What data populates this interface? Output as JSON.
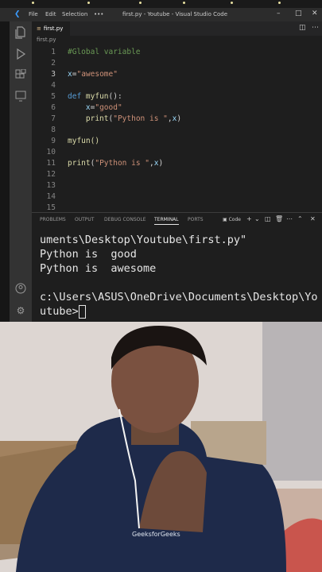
{
  "window": {
    "title": "first.py - Youtube - Visual Studio Code",
    "menu": [
      "File",
      "Edit",
      "Selection",
      "•••"
    ],
    "logo_icon": "vscode-logo-icon"
  },
  "activity_icons": [
    "files-icon",
    "run-debug-icon",
    "extensions-icon",
    "remote-explorer-icon",
    "account-icon",
    "manage-gear-icon"
  ],
  "tab": {
    "label": "first.py"
  },
  "breadcrumb": "first.py",
  "editor": {
    "lines": [
      {
        "n": "1",
        "text": "#Global variable"
      },
      {
        "n": "2",
        "text": ""
      },
      {
        "n": "3",
        "text": "x=\"awesome\""
      },
      {
        "n": "4",
        "text": ""
      },
      {
        "n": "5",
        "text": "def myfun():"
      },
      {
        "n": "6",
        "text": "    x=\"good\""
      },
      {
        "n": "7",
        "text": "    print(\"Python is \",x)"
      },
      {
        "n": "8",
        "text": ""
      },
      {
        "n": "9",
        "text": "myfun()"
      },
      {
        "n": "10",
        "text": ""
      },
      {
        "n": "11",
        "text": "print(\"Python is \",x)"
      },
      {
        "n": "12",
        "text": ""
      },
      {
        "n": "13",
        "text": ""
      },
      {
        "n": "14",
        "text": ""
      },
      {
        "n": "15",
        "text": ""
      }
    ]
  },
  "panel": {
    "tabs": [
      "PROBLEMS",
      "OUTPUT",
      "DEBUG CONSOLE",
      "TERMINAL",
      "PORTS"
    ],
    "active_tab": "TERMINAL",
    "terminal_profile": "Code"
  },
  "terminal": {
    "lines": [
      "uments\\Desktop\\Youtube\\first.py\"",
      "Python is  good",
      "Python is  awesome",
      "",
      "c:\\Users\\ASUS\\OneDrive\\Documents\\Desktop\\Yo",
      "utube>"
    ]
  },
  "colors": {
    "editor_bg": "#1e1e1e",
    "keyword": "#569cd6",
    "string": "#ce9178",
    "comment": "#6a9955",
    "function": "#dcdcaa"
  },
  "video_overlay": {
    "shirt_logo": "GeeksforGeeks"
  }
}
